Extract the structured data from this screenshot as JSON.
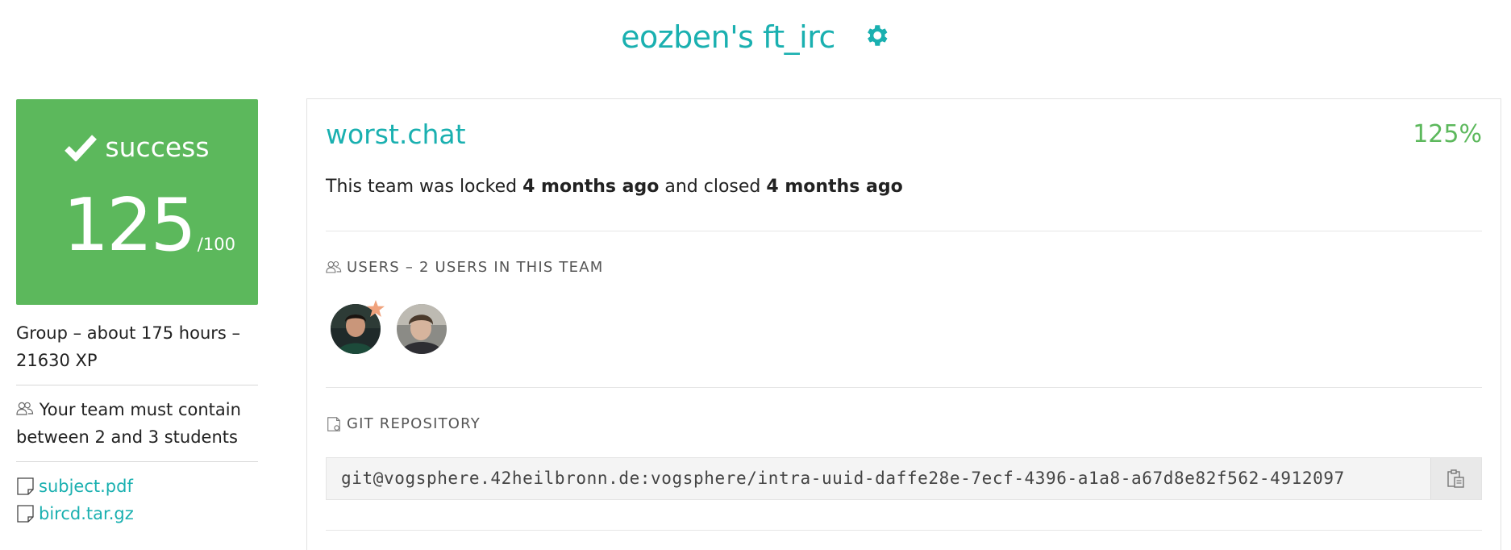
{
  "header": {
    "title": "eozben's ft_irc",
    "gear_icon": "gear-icon"
  },
  "summary": {
    "status": "success",
    "score": "125",
    "score_max": "/100",
    "meta": "Group – about 175 hours – 21630 XP",
    "team_requirement": "Your team must contain between 2 and 3 students",
    "files": [
      "subject.pdf",
      "bircd.tar.gz"
    ]
  },
  "team": {
    "name": "worst.chat",
    "mark": "125%",
    "locked_prefix": "This team was locked ",
    "locked_time": "4 months ago",
    "closed_mid": " and closed ",
    "closed_time": "4 months ago",
    "users_title": "USERS – 2 USERS IN THIS TEAM",
    "git_title": "GIT REPOSITORY",
    "repo_url": "git@vogsphere.42heilbronn.de:vogsphere/intra-uuid-daffe28e-7ecf-4396-a1a8-a67d8e82f562-4912097"
  },
  "colors": {
    "accent": "#1ab0b0",
    "success": "#5cb85c"
  }
}
